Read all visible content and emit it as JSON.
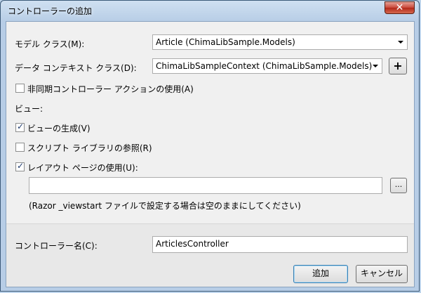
{
  "window": {
    "title": "コントローラーの追加",
    "close_label": "✕"
  },
  "model_class": {
    "label": "モデル クラス(M):",
    "value": "Article (ChimaLibSample.Models)"
  },
  "context_class": {
    "label": "データ コンテキスト クラス(D):",
    "value": "ChimaLibSampleContext (ChimaLibSample.Models)",
    "add_label": "+"
  },
  "async_option": {
    "label": "非同期コントローラー アクションの使用(A)",
    "checked": false
  },
  "views_section": {
    "label": "ビュー:"
  },
  "generate_views": {
    "label": "ビューの生成(V)",
    "checked": true
  },
  "script_libraries": {
    "label": "スクリプト ライブラリの参照(R)",
    "checked": false
  },
  "use_layout": {
    "label": "レイアウト ページの使用(U):",
    "checked": true
  },
  "layout_path": {
    "value": "",
    "browse_label": "..."
  },
  "layout_hint": {
    "text": "(Razor _viewstart ファイルで設定する場合は空のままにしてください)"
  },
  "controller_name": {
    "label": "コントローラー名(C):",
    "value": "ArticlesController"
  },
  "actions": {
    "add_label": "追加",
    "cancel_label": "キャンセル"
  },
  "check_glyph": "✓"
}
